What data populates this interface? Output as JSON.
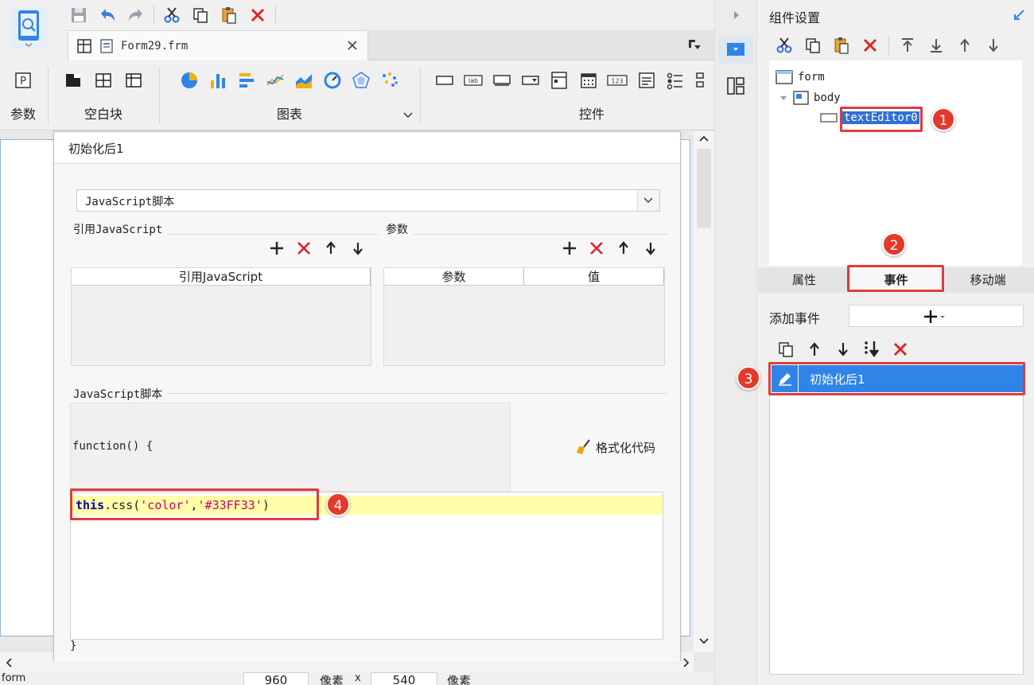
{
  "toolbar": {
    "file_tab": "Form29.frm"
  },
  "ribbon": {
    "groups": {
      "params": "参数",
      "blank": "空白块",
      "charts": "图表",
      "controls": "控件"
    },
    "control_icons": {
      "label": "lab",
      "number": "123"
    }
  },
  "dialog": {
    "title": "初始化后1",
    "type_select": "JavaScript脚本",
    "ref_js_label": "引用JavaScript",
    "ref_js_column": "引用JavaScript",
    "params_label": "参数",
    "params_columns": [
      "参数",
      "值"
    ],
    "script_label": "JavaScript脚本",
    "function_head": "function() {",
    "format_button": "格式化代码",
    "code": {
      "keyword": "this",
      "call": ".css(",
      "arg1": "'color'",
      "comma": ",",
      "arg2": "'#33FF33'",
      "close": ")"
    },
    "function_close": "}"
  },
  "status": {
    "layout": "form",
    "width": "960",
    "unit1": "像素",
    "times": "x",
    "height": "540",
    "unit2": "像素"
  },
  "right_panel": {
    "title": "组件设置",
    "tree": {
      "root": "form",
      "body": "body",
      "selected": "textEditor0"
    },
    "tabs": [
      "属性",
      "事件",
      "移动端"
    ],
    "add_event_label": "添加事件",
    "event_item": "初始化后1"
  },
  "badges": [
    "1",
    "2",
    "3",
    "4"
  ],
  "colors": {
    "accent": "#2f84e8",
    "highlight": "#e03b3b",
    "selection": "#2f6fd6",
    "code_line": "#ffffaa"
  }
}
